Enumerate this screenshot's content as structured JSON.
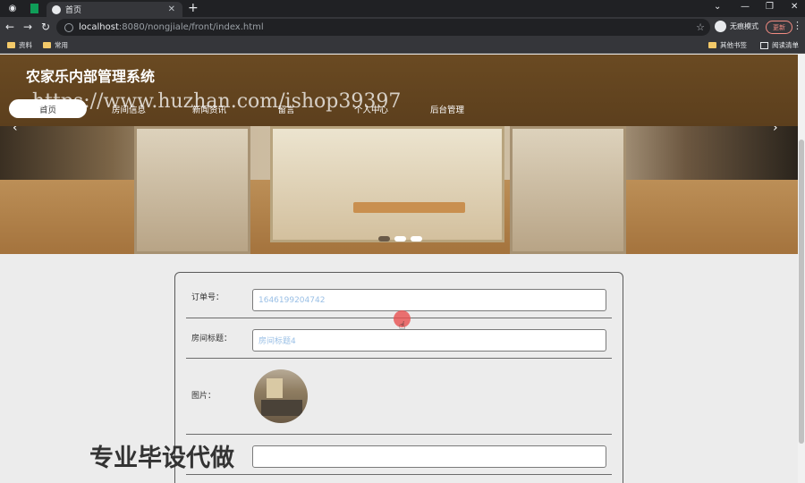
{
  "browser": {
    "active_tab_title": "首页",
    "url_host": "localhost",
    "url_path": ":8080/nongjiale/front/index.html",
    "incognito_label": "无痕模式",
    "update_label": "更新",
    "bookmarks": [
      {
        "label": "资料"
      },
      {
        "label": "常用"
      },
      {
        "label": "其他书签"
      },
      {
        "label": "阅读清单"
      }
    ]
  },
  "site": {
    "title": "农家乐内部管理系统",
    "nav": [
      {
        "label": "首页",
        "active": true
      },
      {
        "label": "房间信息"
      },
      {
        "label": "新闻资讯"
      },
      {
        "label": "留言"
      },
      {
        "label": "个人中心"
      },
      {
        "label": "后台管理"
      }
    ],
    "carousel": {
      "active_index": 0
    }
  },
  "form": {
    "order_label": "订单号：",
    "order_value": "1646199204742",
    "room_title_label": "房间标题：",
    "room_title_value": "房间标题4",
    "image_label": "图片："
  },
  "watermarks": {
    "url_text": "https://www.huzhan.com/ishop39397",
    "promo_text": "专业毕设代做"
  }
}
